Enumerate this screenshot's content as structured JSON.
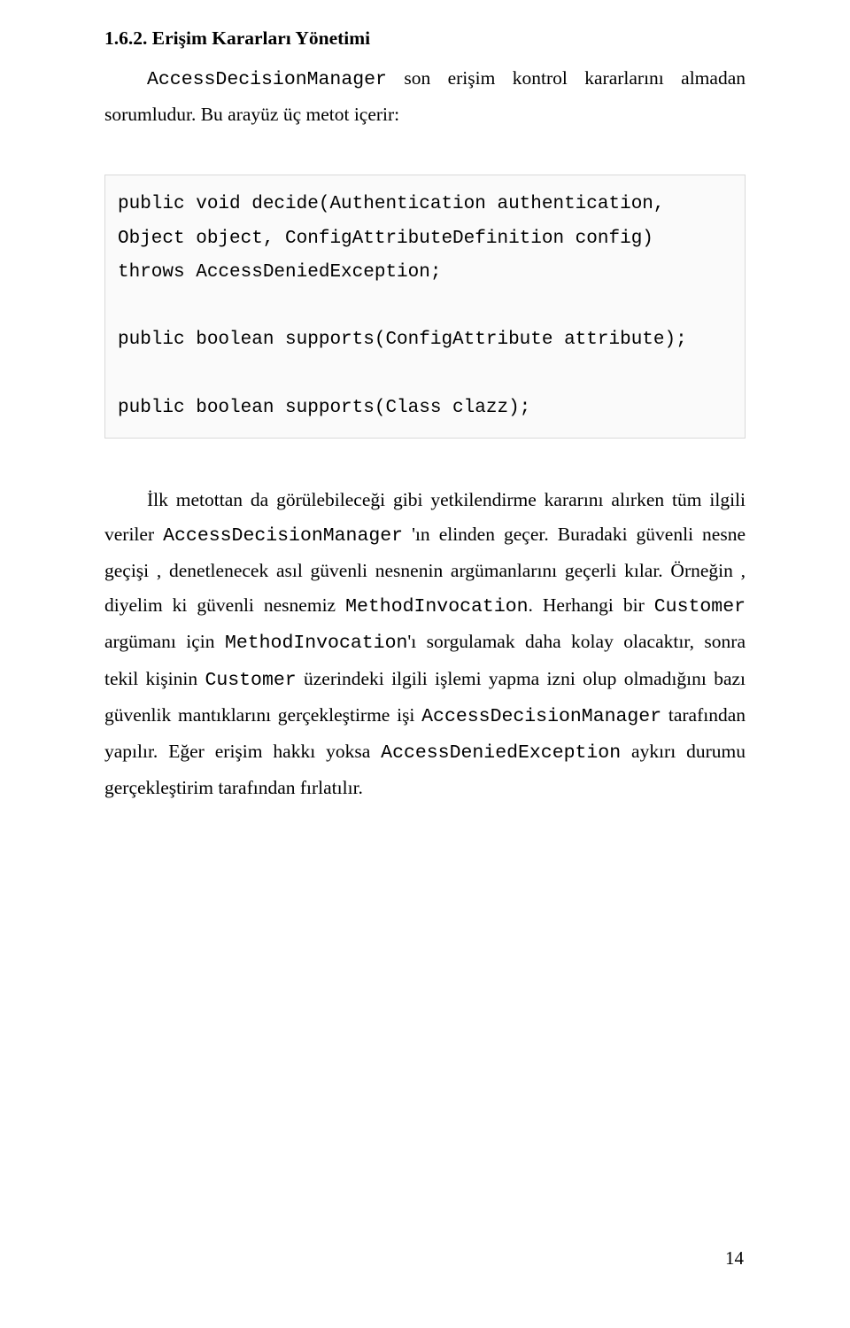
{
  "heading": "1.6.2. Erişim Kararları Yönetimi",
  "intro": {
    "prefix_indent": "        ",
    "mono1": "AccessDecisionManager",
    "text_after_mono1": " son erişim kontrol kararlarını almadan sorumludur. Bu arayüz üç metot içerir:"
  },
  "code": "public void decide(Authentication authentication,\nObject object, ConfigAttributeDefinition config)\nthrows AccessDeniedException;\n\npublic boolean supports(ConfigAttribute attribute);\n\npublic boolean supports(Class clazz);",
  "para2": {
    "text1": "İlk metottan da görülebileceği gibi yetkilendirme kararını alırken tüm ilgili veriler ",
    "mono1": "AccessDecisionManager",
    "text2": " 'ın elinden geçer. Buradaki güvenli nesne geçişi , denetlenecek asıl güvenli nesnenin argümanlarını geçerli kılar. Örneğin , diyelim ki güvenli nesnemiz ",
    "mono2": "MethodInvocation",
    "text3": ". Herhangi bir ",
    "mono3": "Customer",
    "text4": " argümanı için ",
    "mono4": "MethodInvocation",
    "text5": "'ı sorgulamak daha kolay olacaktır, sonra tekil kişinin ",
    "mono5": "Customer",
    "text6": " üzerindeki ilgili işlemi yapma izni olup olmadığını bazı güvenlik mantıklarını gerçekleştirme işi ",
    "mono6": "AccessDecisionManager",
    "text7": " tarafından yapılır. Eğer erişim hakkı yoksa ",
    "mono7": "AccessDeniedException",
    "text8": " aykırı durumu gerçekleştirim tarafından fırlatılır."
  },
  "page_number": "14"
}
